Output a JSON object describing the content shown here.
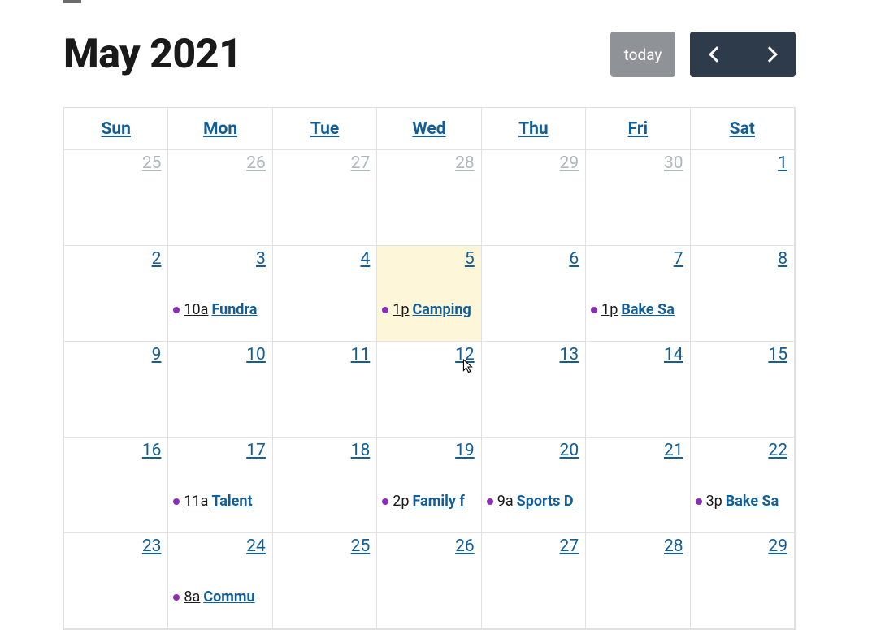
{
  "title": "May 2021",
  "today_label": "today",
  "day_headers": [
    "Sun",
    "Mon",
    "Tue",
    "Wed",
    "Thu",
    "Fri",
    "Sat"
  ],
  "weeks": [
    [
      {
        "num": "25",
        "other": true,
        "today": false,
        "events": []
      },
      {
        "num": "26",
        "other": true,
        "today": false,
        "events": []
      },
      {
        "num": "27",
        "other": true,
        "today": false,
        "events": []
      },
      {
        "num": "28",
        "other": true,
        "today": false,
        "events": []
      },
      {
        "num": "29",
        "other": true,
        "today": false,
        "events": []
      },
      {
        "num": "30",
        "other": true,
        "today": false,
        "events": []
      },
      {
        "num": "1",
        "other": false,
        "today": false,
        "events": []
      }
    ],
    [
      {
        "num": "2",
        "other": false,
        "today": false,
        "events": []
      },
      {
        "num": "3",
        "other": false,
        "today": false,
        "events": [
          {
            "time": "10a",
            "title": "Fundra"
          }
        ]
      },
      {
        "num": "4",
        "other": false,
        "today": false,
        "events": []
      },
      {
        "num": "5",
        "other": false,
        "today": true,
        "events": [
          {
            "time": "1p",
            "title": "Camping"
          }
        ]
      },
      {
        "num": "6",
        "other": false,
        "today": false,
        "events": []
      },
      {
        "num": "7",
        "other": false,
        "today": false,
        "events": [
          {
            "time": "1p",
            "title": "Bake Sa"
          }
        ]
      },
      {
        "num": "8",
        "other": false,
        "today": false,
        "events": []
      }
    ],
    [
      {
        "num": "9",
        "other": false,
        "today": false,
        "events": []
      },
      {
        "num": "10",
        "other": false,
        "today": false,
        "events": []
      },
      {
        "num": "11",
        "other": false,
        "today": false,
        "events": []
      },
      {
        "num": "12",
        "other": false,
        "today": false,
        "events": []
      },
      {
        "num": "13",
        "other": false,
        "today": false,
        "events": []
      },
      {
        "num": "14",
        "other": false,
        "today": false,
        "events": []
      },
      {
        "num": "15",
        "other": false,
        "today": false,
        "events": []
      }
    ],
    [
      {
        "num": "16",
        "other": false,
        "today": false,
        "events": []
      },
      {
        "num": "17",
        "other": false,
        "today": false,
        "events": [
          {
            "time": "11a",
            "title": "Talent "
          }
        ]
      },
      {
        "num": "18",
        "other": false,
        "today": false,
        "events": []
      },
      {
        "num": "19",
        "other": false,
        "today": false,
        "events": [
          {
            "time": "2p",
            "title": "Family f"
          }
        ]
      },
      {
        "num": "20",
        "other": false,
        "today": false,
        "events": [
          {
            "time": "9a",
            "title": "Sports D"
          }
        ]
      },
      {
        "num": "21",
        "other": false,
        "today": false,
        "events": []
      },
      {
        "num": "22",
        "other": false,
        "today": false,
        "events": [
          {
            "time": "3p",
            "title": "Bake Sa"
          }
        ]
      }
    ],
    [
      {
        "num": "23",
        "other": false,
        "today": false,
        "events": []
      },
      {
        "num": "24",
        "other": false,
        "today": false,
        "events": [
          {
            "time": "8a",
            "title": "Commu"
          }
        ]
      },
      {
        "num": "25",
        "other": false,
        "today": false,
        "events": []
      },
      {
        "num": "26",
        "other": false,
        "today": false,
        "events": []
      },
      {
        "num": "27",
        "other": false,
        "today": false,
        "events": []
      },
      {
        "num": "28",
        "other": false,
        "today": false,
        "events": []
      },
      {
        "num": "29",
        "other": false,
        "today": false,
        "events": []
      }
    ]
  ]
}
